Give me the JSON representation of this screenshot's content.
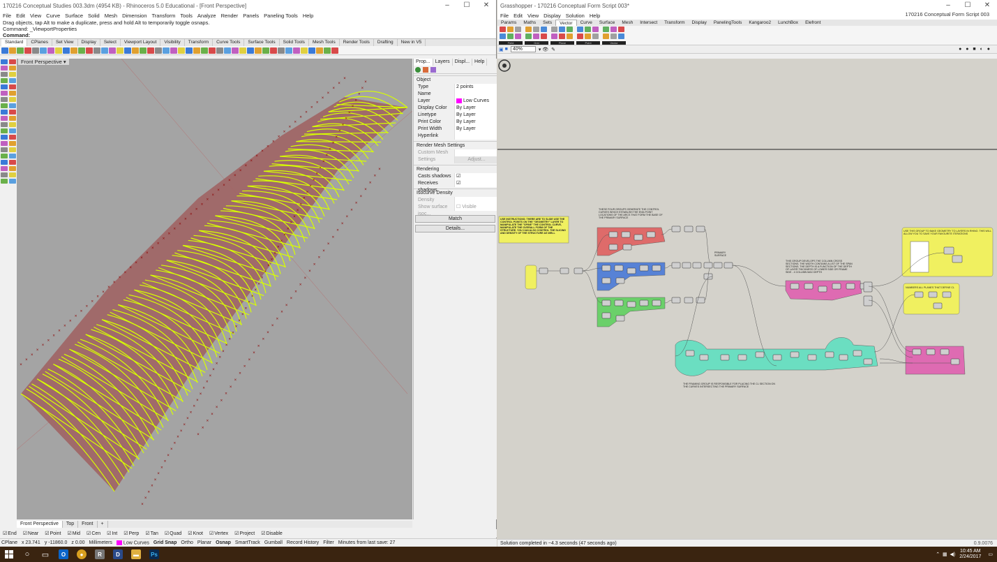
{
  "rhino": {
    "title": "170216 Conceptual Studies 003.3dm (4954 KB) - Rhinoceros 5.0 Educational - [Front Perspective]",
    "window_controls": [
      "–",
      "☐",
      "✕"
    ],
    "menu": [
      "File",
      "Edit",
      "View",
      "Curve",
      "Surface",
      "Solid",
      "Mesh",
      "Dimension",
      "Transform",
      "Tools",
      "Analyze",
      "Render",
      "Panels",
      "Paneling Tools",
      "Help"
    ],
    "command_history": [
      "Drag objects, tap Alt to make a duplicate, press and hold Alt to temporarily toggle osnaps.",
      "Command: _ViewportProperties"
    ],
    "command_prompt": "Command:",
    "toolbar_tabs": [
      "Standard",
      "CPlanes",
      "Set View",
      "Display",
      "Select",
      "Viewport Layout",
      "Visibility",
      "Transform",
      "Curve Tools",
      "Surface Tools",
      "Solid Tools",
      "Mesh Tools",
      "Render Tools",
      "Drafting",
      "New in V5"
    ],
    "viewport_label": "Front Perspective ▾",
    "viewport_tabs": [
      "Front Perspective",
      "Top",
      "Front",
      "+"
    ],
    "osnaps": [
      "End",
      "Near",
      "Point",
      "Mid",
      "Cen",
      "Int",
      "Perp",
      "Tan",
      "Quad",
      "Knot",
      "Vertex",
      "Project",
      "Disable"
    ],
    "status": {
      "cplane": "CPlane",
      "x": "x 23.741",
      "y": "y -11860.0",
      "z": "z 0.00",
      "units": "Millimeters",
      "layer": "Low Curves",
      "layer_color": "#ff00ff",
      "toggles": [
        "Grid Snap",
        "Ortho",
        "Planar",
        "Osnap",
        "SmartTrack",
        "Gumball",
        "Record History",
        "Filter"
      ],
      "autosave": "Minutes from last save: 27"
    },
    "properties": {
      "tabs": [
        "Prop...",
        "Layers",
        "Displ...",
        "Help"
      ],
      "section_object": "Object",
      "rows": [
        {
          "k": "Type",
          "v": "2 points"
        },
        {
          "k": "Name",
          "v": ""
        },
        {
          "k": "Layer",
          "v": "Low Curves"
        },
        {
          "k": "Display Color",
          "v": "By Layer"
        },
        {
          "k": "Linetype",
          "v": "By Layer"
        },
        {
          "k": "Print Color",
          "v": "By Layer"
        },
        {
          "k": "Print Width",
          "v": "By Layer"
        },
        {
          "k": "Hyperlink",
          "v": ""
        }
      ],
      "section_render_mesh": "Render Mesh Settings",
      "custom_mesh": "Custom Mesh",
      "settings": "Settings",
      "adjust": "Adjust...",
      "section_rendering": "Rendering",
      "casts_shadows": "Casts shadows",
      "receives_shadows": "Receives shadows",
      "section_isocurve": "Isocurve Density",
      "density": "Density",
      "show_iso": "Show surface isoc...",
      "visible": "Visible",
      "match_btn": "Match",
      "details_btn": "Details..."
    }
  },
  "grasshopper": {
    "title": "Grasshopper - 170216 Conceptual Form Script 003*",
    "window_controls": [
      "–",
      "☐",
      "✕"
    ],
    "menu": [
      "File",
      "Edit",
      "View",
      "Display",
      "Solution",
      "Help"
    ],
    "document_name": "170216 Conceptual Form Script 003",
    "tabs": [
      "Params",
      "Maths",
      "Sets",
      "Vector",
      "Curve",
      "Surface",
      "Mesh",
      "Intersect",
      "Transform",
      "Display",
      "PanelingTools",
      "Kangaroo2",
      "LunchBox",
      "Elefront"
    ],
    "active_tab": "Vector",
    "ribbon_groups": [
      "Field",
      "Grid",
      "Plane",
      "Point",
      "Vector"
    ],
    "zoom": "40%",
    "notes": {
      "user_instructions": "USE INSTRUCTIONS: THERE ARE TO SLIDE USE THE CONTROL POINTS ON THE \"GEOMETRY\" LAYER TO MANIPULATE THE \"SPINE\" THE CONTROL CURVE, MANIPULATE THE OVERALL FORM OF THE STRUCTURE. YOU CAN ALSO CONTROL THE SLICING AND DENSITY OF THE STRUCTURE AS WELL",
      "groups_top": "THESE FOUR GROUPS GENERATE THE CONTROL CURVES WHICH ESTABLISH THE END-POINT LOCATIONS OF THE ARCS THAT FORM THE BASE OF THE PRIMARY SURFACE",
      "primary_surface": "PRIMARY SURFACE",
      "cross_sections": "THIS GROUP DEVELOPS THE COLUMN CROSS SECTIONS. THE WIDTH CONTAINS A LIST OF THE SPAN SECTIONS. THE DEPTH IS A FUNCTION OF THE DEPTH OF LAYER THICKNESS OF LOWER SIDE OR FRAME SIDE - 4 COLUMN MAX DEPTH",
      "bake_group": "USE THIS GROUP TO BAKE GEOMETRY TO LAYERS IN RHINO. THIS WILL ALLOW YOU TO SAVE YOUR FAVOURITE ITERATIONS",
      "numbers_planes": "NUMBERS ALL PLANES THAT DEFINE CL",
      "framing_group": "THE FRAMING GROUP IS RESPONSIBLE FOR PLACING THE CL SECTION ON THE CURVES INTERSECTING THE PRIMARY SURFACE"
    },
    "status": "Solution completed in ~4.3 seconds (47 seconds ago)",
    "version": "0.9.0076"
  },
  "taskbar": {
    "time": "10:45 AM",
    "date": "2/24/2017",
    "apps": [
      "Outlook",
      "Chrome",
      "Rhino",
      "Dropbox",
      "Folder",
      "Photoshop"
    ]
  },
  "colors": {
    "viewport_bg": "#a4a4a4",
    "surface_fill": "#a06060",
    "structure_lines": "#d8ff00",
    "control_points": "#8b0000",
    "gh_red_group": "#e06060",
    "gh_blue_group": "#4a7ad8",
    "gh_green_group": "#60d060",
    "gh_pink_group": "#e060b0",
    "gh_teal_group": "#60e0c0",
    "gh_yellow_group": "#f0f060"
  }
}
